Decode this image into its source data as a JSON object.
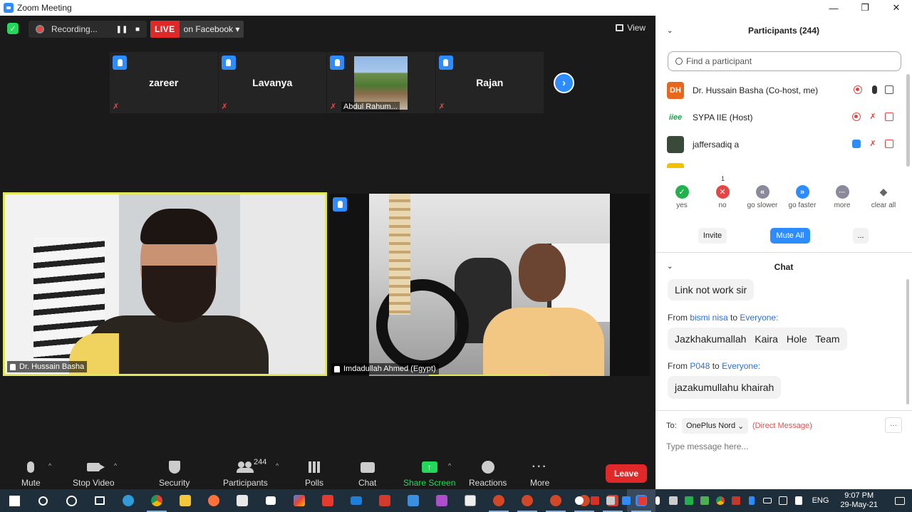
{
  "window": {
    "title": "Zoom Meeting",
    "controls": [
      "—",
      "❐",
      "✕"
    ]
  },
  "topbar": {
    "recording_label": "Recording...",
    "live_badge": "LIVE",
    "live_target": "on Facebook",
    "view_label": "View"
  },
  "thumbnails": [
    {
      "name": "zareer"
    },
    {
      "name": "Lavanya"
    },
    {
      "name": "Abdul Rahum..."
    },
    {
      "name": "Rajan"
    }
  ],
  "main_videos": [
    {
      "name": "Dr. Hussain Basha"
    },
    {
      "name": "Imdadullah Ahmed (Egypt)"
    }
  ],
  "toolbar": {
    "mute": "Mute",
    "stop_video": "Stop Video",
    "security": "Security",
    "participants": "Participants",
    "participant_count": "244",
    "polls": "Polls",
    "chat": "Chat",
    "share_screen": "Share Screen",
    "reactions": "Reactions",
    "more": "More",
    "leave": "Leave"
  },
  "participants_panel": {
    "title": "Participants (244)",
    "search_placeholder": "Find a participant",
    "list": [
      {
        "initials": "DH",
        "name": "Dr. Hussain Basha (Co-host, me)",
        "avatar_color": "#e8671c"
      },
      {
        "initials": "iiee",
        "name": "SYPA IIE (Host)",
        "avatar_color": "#ffffff"
      },
      {
        "initials": "",
        "name": "jaffersadiq a",
        "avatar_color": "#3a4a3a"
      },
      {
        "initials": "",
        "name": "",
        "avatar_color": "#f2c200"
      }
    ],
    "reactions": [
      {
        "label": "yes",
        "color": "#23b14d",
        "glyph": "✓"
      },
      {
        "label": "no",
        "color": "#e64545",
        "glyph": "✕",
        "count": "1"
      },
      {
        "label": "go slower",
        "color": "#8a8a9a",
        "glyph": "«"
      },
      {
        "label": "go faster",
        "color": "#2d8cff",
        "glyph": "»"
      },
      {
        "label": "more",
        "color": "#8a8a9a",
        "glyph": "···"
      },
      {
        "label": "clear all",
        "color": "#666666",
        "glyph": "◆"
      }
    ],
    "invite": "Invite",
    "mute_all": "Mute All",
    "more_btn": "..."
  },
  "chat_panel": {
    "title": "Chat",
    "messages": [
      {
        "text": "Link not work sir"
      },
      {
        "from_prefix": "From",
        "sender": "bismi nisa",
        "to_word": "to",
        "recipient": "Everyone:",
        "text": "Jazkhakumallah Kaira Hole Team"
      },
      {
        "from_prefix": "From",
        "sender": "P048",
        "to_word": "to",
        "recipient": "Everyone:",
        "text": "jazakumullahu khairah"
      }
    ],
    "to_label": "To:",
    "to_target": "OnePlus Nord",
    "direct_message": "(Direct Message)",
    "input_placeholder": "Type message here...",
    "more_btn": "···"
  },
  "taskbar": {
    "language": "ENG",
    "time": "9:07 PM",
    "date": "29-May-21"
  }
}
